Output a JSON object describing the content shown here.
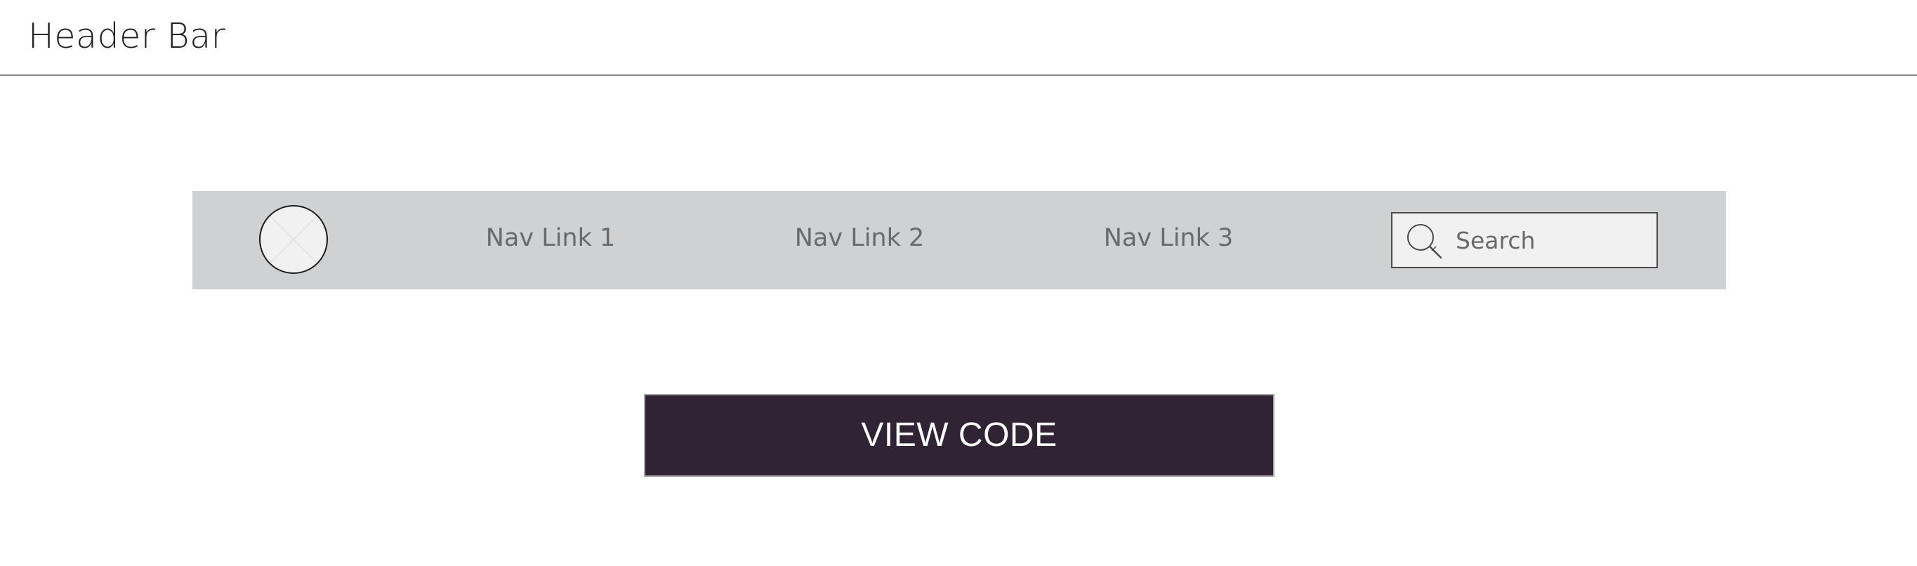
{
  "header": {
    "title": "Header Bar"
  },
  "nav": {
    "logo_icon": "image-placeholder-icon",
    "links": [
      {
        "label": "Nav Link 1"
      },
      {
        "label": "Nav Link 2"
      },
      {
        "label": "Nav Link 3"
      }
    ],
    "search": {
      "placeholder": "Search",
      "value": "",
      "icon": "search-icon"
    }
  },
  "main": {
    "view_code_label": "VIEW CODE"
  },
  "colors": {
    "page_background": "#ffffff",
    "header_divider": "#8a8a8a",
    "nav_background": "#d0d1d2",
    "nav_text": "#6a6a6a",
    "search_background": "#f1f1f1",
    "button_background": "#2f2334",
    "button_text": "#ffffff"
  }
}
